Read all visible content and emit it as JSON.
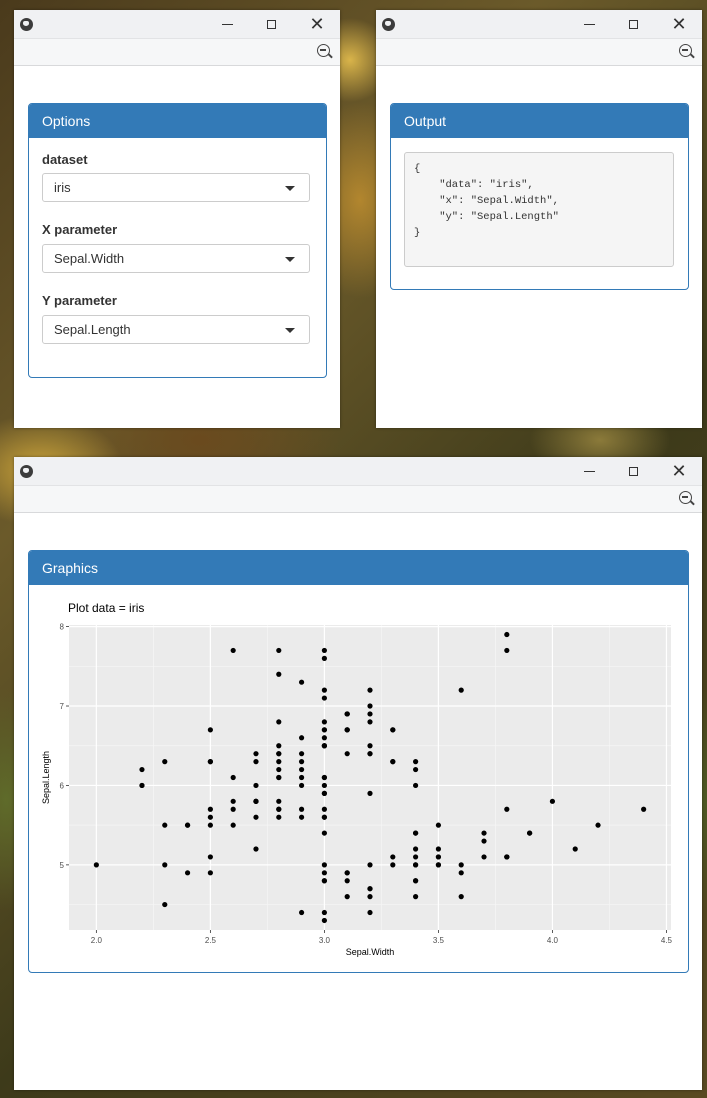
{
  "window_controls": {
    "minimize": "—",
    "maximize": "□",
    "close": "✕"
  },
  "options": {
    "title": "Options",
    "dataset": {
      "label": "dataset",
      "value": "iris"
    },
    "x_param": {
      "label": "X parameter",
      "value": "Sepal.Width"
    },
    "y_param": {
      "label": "Y parameter",
      "value": "Sepal.Length"
    }
  },
  "output": {
    "title": "Output",
    "json_text": "{\n    \"data\": \"iris\",\n    \"x\": \"Sepal.Width\",\n    \"y\": \"Sepal.Length\"\n}"
  },
  "graphics": {
    "title": "Graphics",
    "plot_title": "Plot data = iris"
  },
  "chart_data": {
    "type": "scatter",
    "title": "Plot data = iris",
    "xlabel": "Sepal.Width",
    "ylabel": "Sepal.Length",
    "xlim": [
      1.88,
      4.52
    ],
    "ylim": [
      4.18,
      8.02
    ],
    "xticks": [
      "2.0",
      "2.5",
      "3.0",
      "3.5",
      "4.0",
      "4.5"
    ],
    "yticks": [
      "5",
      "6",
      "7",
      "8"
    ],
    "grid": true,
    "background": "#ebebeb",
    "point_color": "#000000",
    "x": [
      3.5,
      3.0,
      3.2,
      3.1,
      3.6,
      3.9,
      3.4,
      3.4,
      2.9,
      3.1,
      3.7,
      3.4,
      3.0,
      3.0,
      4.0,
      4.4,
      3.9,
      3.5,
      3.8,
      3.8,
      3.4,
      3.7,
      3.6,
      3.3,
      3.4,
      3.0,
      3.4,
      3.5,
      3.4,
      3.2,
      3.1,
      3.4,
      4.1,
      4.2,
      3.1,
      3.2,
      3.5,
      3.6,
      3.0,
      3.4,
      3.5,
      2.3,
      3.2,
      3.5,
      3.8,
      3.0,
      3.8,
      3.2,
      3.7,
      3.3,
      3.2,
      3.2,
      3.1,
      2.3,
      2.8,
      2.8,
      3.3,
      2.4,
      2.9,
      2.7,
      2.0,
      3.0,
      2.2,
      2.9,
      2.9,
      3.1,
      3.0,
      2.7,
      2.2,
      2.5,
      3.2,
      2.8,
      2.5,
      2.8,
      2.9,
      3.0,
      2.8,
      3.0,
      2.9,
      2.6,
      2.4,
      2.4,
      2.7,
      2.7,
      3.0,
      3.4,
      3.1,
      2.3,
      3.0,
      2.5,
      2.6,
      3.0,
      2.6,
      2.3,
      2.7,
      3.0,
      2.9,
      2.9,
      2.5,
      2.8,
      3.3,
      2.7,
      3.0,
      2.9,
      3.0,
      3.0,
      2.5,
      2.9,
      2.5,
      3.6,
      3.2,
      2.7,
      3.0,
      2.5,
      2.8,
      3.2,
      3.0,
      3.8,
      2.6,
      2.2,
      3.2,
      2.8,
      2.8,
      2.7,
      3.3,
      3.2,
      2.8,
      3.0,
      2.8,
      3.0,
      2.8,
      3.8,
      2.8,
      2.8,
      2.6,
      3.0,
      3.4,
      3.1,
      3.0,
      3.1,
      3.1,
      3.1,
      2.7,
      3.2,
      3.3,
      3.0,
      2.5,
      3.0,
      3.4,
      3.0
    ],
    "y": [
      5.1,
      4.9,
      4.7,
      4.6,
      5.0,
      5.4,
      4.6,
      5.0,
      4.4,
      4.9,
      5.4,
      4.8,
      4.8,
      4.3,
      5.8,
      5.7,
      5.4,
      5.1,
      5.7,
      5.1,
      5.4,
      5.1,
      4.6,
      5.1,
      4.8,
      5.0,
      5.0,
      5.2,
      5.2,
      4.7,
      4.8,
      5.4,
      5.2,
      5.5,
      4.9,
      5.0,
      5.5,
      4.9,
      4.4,
      5.1,
      5.0,
      4.5,
      4.4,
      5.0,
      5.1,
      4.8,
      5.1,
      4.6,
      5.3,
      5.0,
      7.0,
      6.4,
      6.9,
      5.5,
      6.5,
      5.7,
      6.3,
      4.9,
      6.6,
      5.2,
      5.0,
      5.9,
      6.0,
      6.1,
      5.6,
      6.7,
      5.6,
      5.8,
      6.2,
      5.6,
      5.9,
      6.1,
      6.3,
      6.1,
      6.4,
      6.6,
      6.8,
      6.7,
      6.0,
      5.7,
      5.5,
      5.5,
      5.8,
      6.0,
      5.4,
      6.0,
      6.7,
      6.3,
      5.6,
      5.5,
      5.5,
      6.1,
      5.8,
      5.0,
      5.6,
      5.7,
      5.7,
      6.2,
      5.1,
      5.7,
      6.3,
      5.8,
      7.1,
      6.3,
      6.5,
      7.6,
      4.9,
      7.3,
      6.7,
      7.2,
      6.5,
      6.4,
      6.8,
      5.7,
      5.8,
      6.4,
      6.5,
      7.7,
      7.7,
      6.0,
      6.9,
      5.6,
      7.7,
      6.3,
      6.7,
      7.2,
      6.2,
      6.1,
      6.4,
      7.2,
      7.4,
      7.9,
      6.4,
      6.3,
      6.1,
      7.7,
      6.3,
      6.4,
      6.0,
      6.9,
      6.7,
      6.9,
      5.8,
      6.8,
      6.7,
      6.7,
      6.3,
      6.5,
      6.2,
      5.9
    ]
  }
}
